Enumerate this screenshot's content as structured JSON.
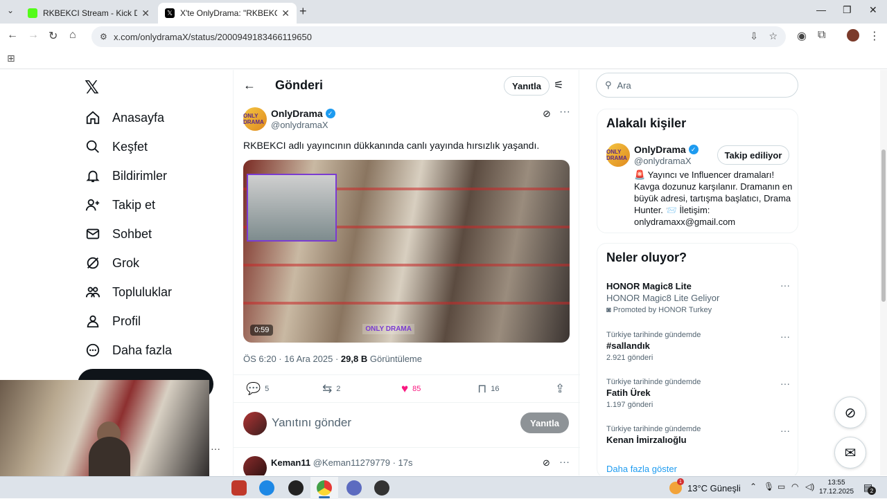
{
  "browser": {
    "tabs": [
      {
        "title": "RKBEKCI Stream - Kick Dashboa",
        "favicon_color": "#53fc18"
      },
      {
        "title": "X'te OnlyDrama: \"RKBEKCI adlı y",
        "favicon_color": "#000000"
      }
    ],
    "url": "x.com/onlydramaX/status/2000949183466119650"
  },
  "nav": {
    "items": [
      {
        "label": "Anasayfa",
        "icon": "home-icon"
      },
      {
        "label": "Keşfet",
        "icon": "search-icon"
      },
      {
        "label": "Bildirimler",
        "icon": "bell-icon"
      },
      {
        "label": "Takip et",
        "icon": "person-add-icon"
      },
      {
        "label": "Sohbet",
        "icon": "mail-icon"
      },
      {
        "label": "Grok",
        "icon": "grok-icon"
      },
      {
        "label": "Topluluklar",
        "icon": "communities-icon"
      },
      {
        "label": "Profil",
        "icon": "profile-icon"
      },
      {
        "label": "Daha fazla",
        "icon": "more-circle-icon"
      }
    ]
  },
  "post": {
    "header_title": "Gönderi",
    "reply_pill": "Yanıtla",
    "author_name": "OnlyDrama",
    "author_handle": "@onlydramaX",
    "avatar_text": "ONLY DRAMA",
    "text": "RKBEKCI adlı yayıncının dükkanında canlı yayında hırsızlık yaşandı.",
    "video_duration": "0:59",
    "watermark": "ONLY DRAMA",
    "time": "ÖS 6:20 · 16 Ara 2025 · ",
    "views": "29,8 B",
    "views_label": " Görüntüleme",
    "stats": {
      "replies": "5",
      "reposts": "2",
      "likes": "85",
      "bookmarks": "16"
    },
    "like_color": "#f91880"
  },
  "composer": {
    "placeholder": "Yanıtını gönder",
    "button": "Yanıtla"
  },
  "reply": {
    "name": "Keman11",
    "meta": " @Keman11279779 · 17s"
  },
  "sidebar": {
    "search_placeholder": "Ara",
    "related_title": "Alakalı kişiler",
    "person": {
      "name": "OnlyDrama",
      "handle": "@onlydramaX",
      "follow_label": "Takip ediliyor",
      "bio": "🚨 Yayıncı ve Influencer dramaları! Kavga dozunuz karşılanır. Dramanın en büyük adresi, tartışma başlatıcı, Drama Hunter. 📨 İletişim: onlydramaxx@gmail.com"
    },
    "trends_title": "Neler oluyor?",
    "trends": [
      {
        "context": "",
        "name": "HONOR Magic8 Lite",
        "sub": "HONOR Magic8 Lite Geliyor",
        "count": "Promoted by HONOR Turkey"
      },
      {
        "context": "Türkiye tarihinde gündemde",
        "name": "#sallandık",
        "sub": "",
        "count": "2.921 gönderi"
      },
      {
        "context": "Türkiye tarihinde gündemde",
        "name": "Fatih Ürek",
        "sub": "",
        "count": "1.197 gönderi"
      },
      {
        "context": "Türkiye tarihinde gündemde",
        "name": "Kenan İmirzalıoğlu",
        "sub": "",
        "count": ""
      }
    ],
    "show_more": "Daha fazla göster"
  },
  "taskbar": {
    "weather_temp": "13°C",
    "weather_text": "Güneşli",
    "weather_badge": "1",
    "time": "13:55",
    "date": "17.12.2025",
    "notifications": "2"
  }
}
